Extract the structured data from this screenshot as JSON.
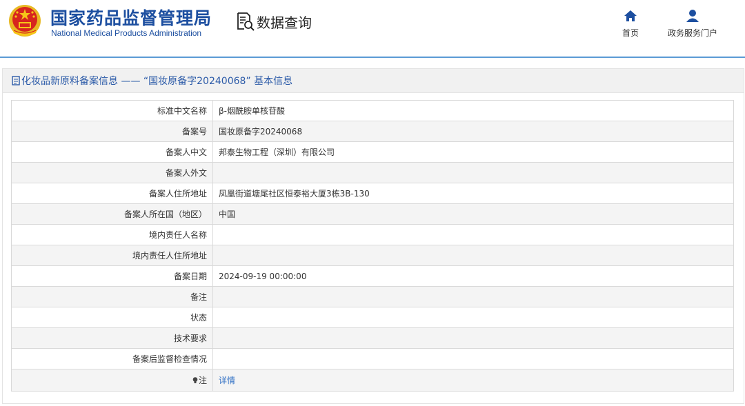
{
  "header": {
    "org_name_cn": "国家药品监督管理局",
    "org_name_en": "National Medical Products Administration",
    "query_label": "数据查询",
    "nav": [
      {
        "label": "首页",
        "icon": "home-icon"
      },
      {
        "label": "政务服务门户",
        "icon": "user-icon"
      }
    ]
  },
  "panel": {
    "title": "化妆品新原料备案信息 —— “国妆原备字20240068” 基本信息",
    "rows": [
      {
        "key": "标准中文名称",
        "value": "β-烟酰胺单核苷酸"
      },
      {
        "key": "备案号",
        "value": "国妆原备字20240068"
      },
      {
        "key": "备案人中文",
        "value": "邦泰生物工程（深圳）有限公司"
      },
      {
        "key": "备案人外文",
        "value": ""
      },
      {
        "key": "备案人住所地址",
        "value": "凤凰街道塘尾社区恒泰裕大厦3栋3B-130"
      },
      {
        "key": "备案人所在国（地区）",
        "value": "中国"
      },
      {
        "key": "境内责任人名称",
        "value": ""
      },
      {
        "key": "境内责任人住所地址",
        "value": ""
      },
      {
        "key": "备案日期",
        "value": "2024-09-19 00:00:00"
      },
      {
        "key": "备注",
        "value": ""
      },
      {
        "key": "状态",
        "value": ""
      },
      {
        "key": "技术要求",
        "value": ""
      },
      {
        "key": "备案后监督检查情况",
        "value": ""
      }
    ],
    "note": {
      "key": "注",
      "link_label": "详情"
    }
  },
  "colors": {
    "brand_blue": "#1d4fa0",
    "link_blue": "#2f6fc4",
    "header_rule": "#5b9bd5",
    "emblem_red": "#d7261e",
    "emblem_gold": "#f5c518"
  }
}
